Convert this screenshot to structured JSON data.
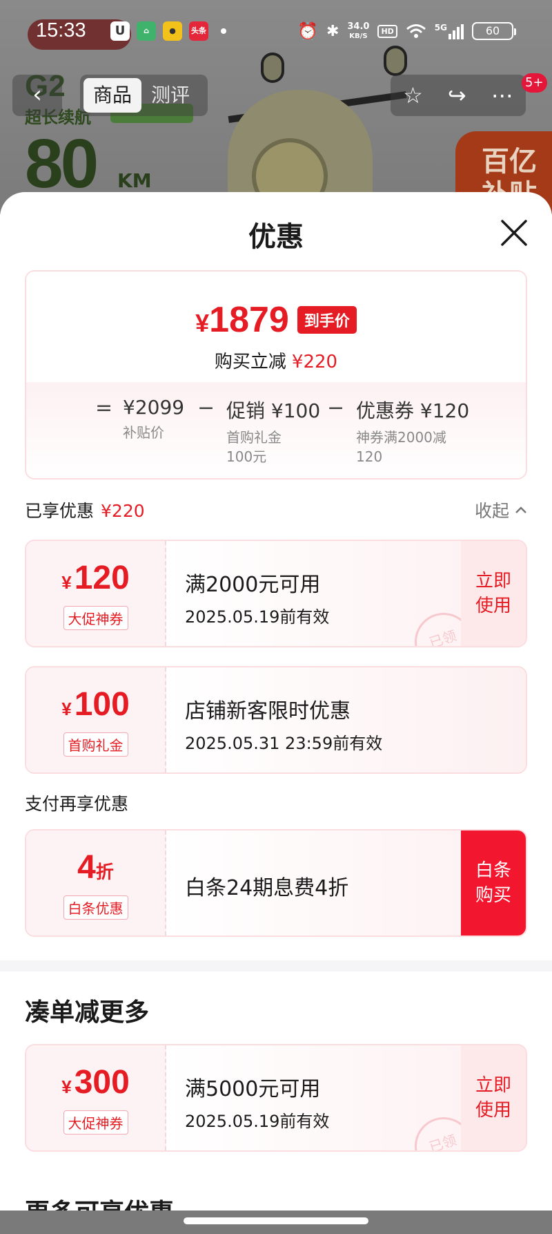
{
  "status_bar": {
    "time": "15:33",
    "apps": [
      "头条"
    ],
    "network_speed_value": "34.0",
    "network_speed_unit": "KB/S",
    "hd": "HD",
    "net_type": "5G",
    "battery": "60"
  },
  "background": {
    "model": "G2",
    "tagline": "超长续航",
    "range_value": "80",
    "range_unit": "KM",
    "subsidy_badge": "百亿\n补贴"
  },
  "nav": {
    "tabs": [
      "商品",
      "测评"
    ],
    "active_tab": 0,
    "message_badge": "5+"
  },
  "sheet": {
    "title": "优惠",
    "summary": {
      "final_price_symbol": "¥",
      "final_price": "1879",
      "final_tag": "到手价",
      "reduce_label": "购买立减",
      "reduce_amount": "¥220",
      "breakdown": [
        {
          "op": "=",
          "value": "¥2099",
          "sub": "补贴价"
        },
        {
          "op": "−",
          "value": "促销 ¥100",
          "sub": "首购礼金\n100元"
        },
        {
          "op": "−",
          "value": "优惠券 ¥120",
          "sub": "神券满2000减\n120"
        }
      ]
    },
    "enjoyed": {
      "label": "已享优惠",
      "amount": "¥220",
      "collapse_label": "收起"
    },
    "coupons": [
      {
        "amount": "120",
        "tag": "大促神券",
        "condition": "满2000元可用",
        "validity": "2025.05.19前有效",
        "action": "立即\n使用",
        "stamp": "已领"
      },
      {
        "amount": "100",
        "tag": "首购礼金",
        "condition": "店铺新客限时优惠",
        "validity": "2025.05.31 23:59前有效"
      }
    ],
    "pay_section": {
      "title": "支付再享优惠",
      "offer": {
        "amount": "4",
        "unit": "折",
        "tag": "白条优惠",
        "description": "白条24期息费4折",
        "action": "白条\n购买"
      }
    },
    "more_section": {
      "title": "凑单减更多",
      "coupon": {
        "amount": "300",
        "tag": "大促神券",
        "condition": "满5000元可用",
        "validity": "2025.05.19前有效",
        "action": "立即\n使用",
        "stamp": "已领"
      }
    },
    "more_available_title": "更多可享优惠"
  },
  "colors": {
    "accent_red": "#e51c23",
    "coupon_border": "#fbdde0",
    "coupon_bg": "#fdf3f4",
    "solid_button": "#f2172f"
  }
}
